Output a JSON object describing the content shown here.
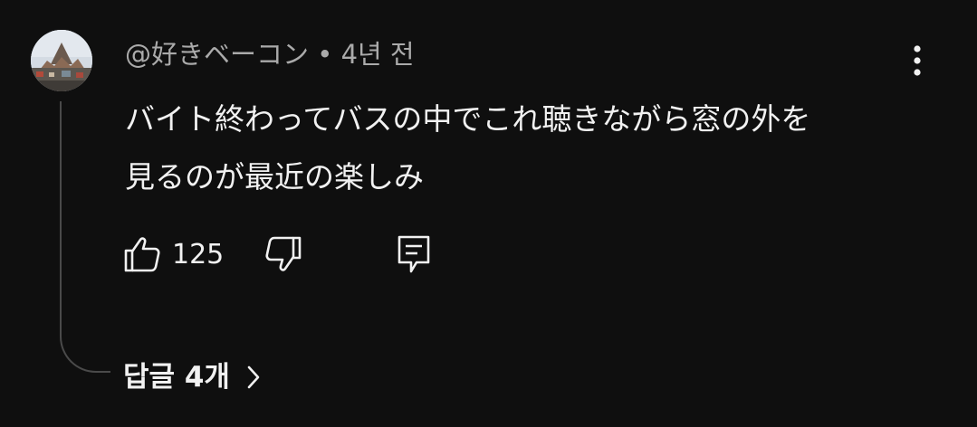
{
  "comment": {
    "author": "@好きベーコン",
    "separator": " • ",
    "time_ago": "4년 전",
    "text_line1": "バイト終わってバスの中でこれ聴きながら窓の外を",
    "text_line2": "見るのが最近の楽しみ",
    "like_count": "125",
    "replies_label": "답글 4개"
  },
  "icons": {
    "avatar": "avatar-image",
    "more": "more-vert-icon",
    "like": "thumb-up-icon",
    "dislike": "thumb-down-icon",
    "reply": "comment-icon",
    "chevron": "chevron-right-icon"
  },
  "colors": {
    "background": "#0f0f0f",
    "text_primary": "#f1f1f1",
    "text_secondary": "#aaaaaa",
    "thread_line": "#4a4a4a"
  }
}
